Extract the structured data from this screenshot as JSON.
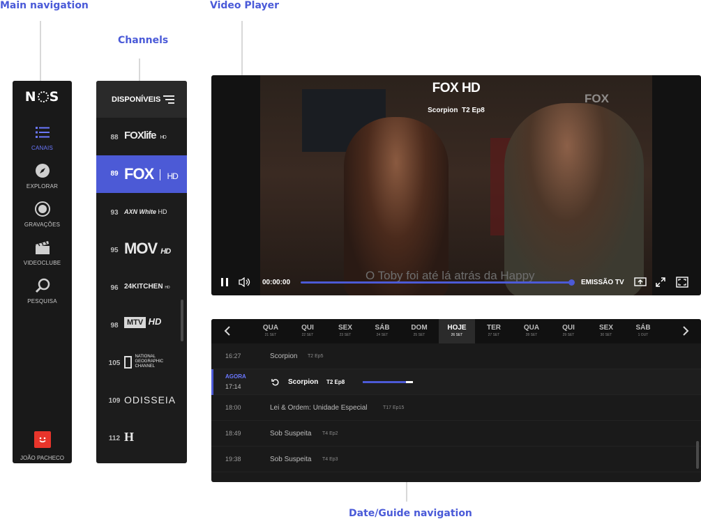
{
  "annotations": {
    "main_navigation": "Main navigation",
    "channels": "Channels",
    "video_player": "Video Player",
    "guide": "Date/Guide navigation"
  },
  "nav": {
    "logo": "NOS",
    "items": [
      {
        "label": "CANAIS",
        "icon": "list-icon",
        "active": true
      },
      {
        "label": "EXPLORAR",
        "icon": "compass-icon",
        "active": false
      },
      {
        "label": "GRAVAÇÕES",
        "icon": "record-icon",
        "active": false
      },
      {
        "label": "VIDEOCLUBE",
        "icon": "clapperboard-icon",
        "active": false
      },
      {
        "label": "PESQUISA",
        "icon": "search-icon",
        "active": false
      }
    ],
    "user": {
      "name": "JOÃO PACHECO",
      "avatar": "smiley-avatar"
    }
  },
  "channels": {
    "filter_label": "DISPONÍVEIS",
    "items": [
      {
        "number": "88",
        "logo": "FOXlife",
        "logo_suffix": "HD",
        "active": false
      },
      {
        "number": "89",
        "logo": "FOX",
        "logo_suffix": "HD",
        "active": true
      },
      {
        "number": "93",
        "logo": "AXN White",
        "logo_suffix": "HD",
        "active": false
      },
      {
        "number": "95",
        "logo": "MOV",
        "logo_suffix": "HD",
        "active": false
      },
      {
        "number": "96",
        "logo": "24KITCHEN",
        "logo_suffix": "HD",
        "active": false
      },
      {
        "number": "98",
        "logo": "MTV",
        "logo_suffix": "HD",
        "active": false
      },
      {
        "number": "105",
        "logo": "NATIONAL GEOGRAPHIC CHANNEL",
        "logo_suffix": "",
        "active": false
      },
      {
        "number": "109",
        "logo": "ODISSEIA",
        "logo_suffix": "",
        "active": false
      },
      {
        "number": "112",
        "logo": "H",
        "logo_suffix": "",
        "active": false
      }
    ]
  },
  "player": {
    "channel": "FOX HD",
    "show": "Scorpion",
    "episode": "T2 Ep8",
    "watermark": "FOX",
    "subtitle": "O Toby foi até lá atrás da Happy",
    "time": "00:00:00",
    "progress_fraction": 1.0,
    "emission_label": "EMISSÃO TV"
  },
  "guide": {
    "days": [
      {
        "day": "QUA",
        "date": "21 SET",
        "today": false
      },
      {
        "day": "QUI",
        "date": "22 SET",
        "today": false
      },
      {
        "day": "SEX",
        "date": "23 SET",
        "today": false
      },
      {
        "day": "SÁB",
        "date": "24 SET",
        "today": false
      },
      {
        "day": "DOM",
        "date": "25 SET",
        "today": false
      },
      {
        "day": "HOJE",
        "date": "26 SET",
        "today": true
      },
      {
        "day": "TER",
        "date": "27 SET",
        "today": false
      },
      {
        "day": "QUA",
        "date": "28 SET",
        "today": false
      },
      {
        "day": "QUI",
        "date": "29 SET",
        "today": false
      },
      {
        "day": "SEX",
        "date": "30 SET",
        "today": false
      },
      {
        "day": "SÁB",
        "date": "1 OUT",
        "today": false
      }
    ],
    "programs": [
      {
        "time": "16:27",
        "title": "Scorpion",
        "episode": "T2 Ep5",
        "now": false
      },
      {
        "time": "17:14",
        "title": "Scorpion",
        "episode": "T2 Ep8",
        "now": true,
        "now_label": "AGORA",
        "progress_fraction": 0.86
      },
      {
        "time": "18:00",
        "title": "Lei & Ordem: Unidade Especial",
        "episode": "T17 Ep15",
        "now": false
      },
      {
        "time": "18:49",
        "title": "Sob Suspeita",
        "episode": "T4 Ep2",
        "now": false
      },
      {
        "time": "19:38",
        "title": "Sob Suspeita",
        "episode": "T4 Ep3",
        "now": false
      }
    ]
  },
  "colors": {
    "accent": "#4c5ad6",
    "panel": "#1c1c1c",
    "avatar": "#e8352b"
  }
}
